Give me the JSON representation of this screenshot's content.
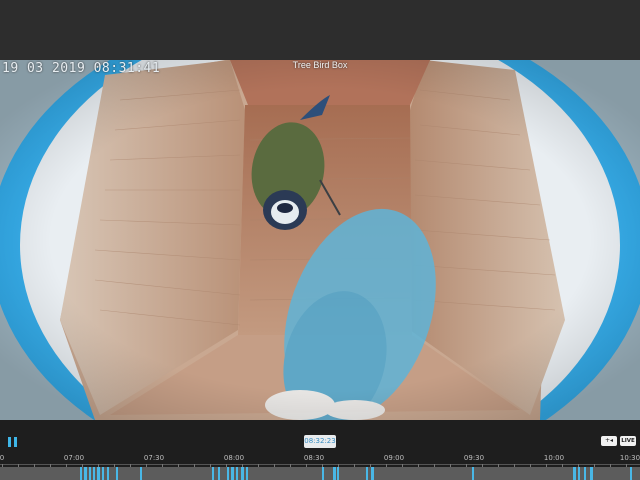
{
  "overlay": {
    "timestamp": "19 03 2019 08:31:41",
    "camera_title": "Tree Bird Box"
  },
  "controls": {
    "pause_icon": "pause-icon",
    "current_time": "08:32:23",
    "back_label": "+◂",
    "live_label": "LIVE"
  },
  "timeline": {
    "labels": [
      "0",
      "07:00",
      "07:30",
      "08:00",
      "08:30",
      "09:00",
      "09:30",
      "10:00",
      "10:30"
    ],
    "colors": {
      "track": "#5c5c5c",
      "recording": "#49b7e6"
    }
  }
}
